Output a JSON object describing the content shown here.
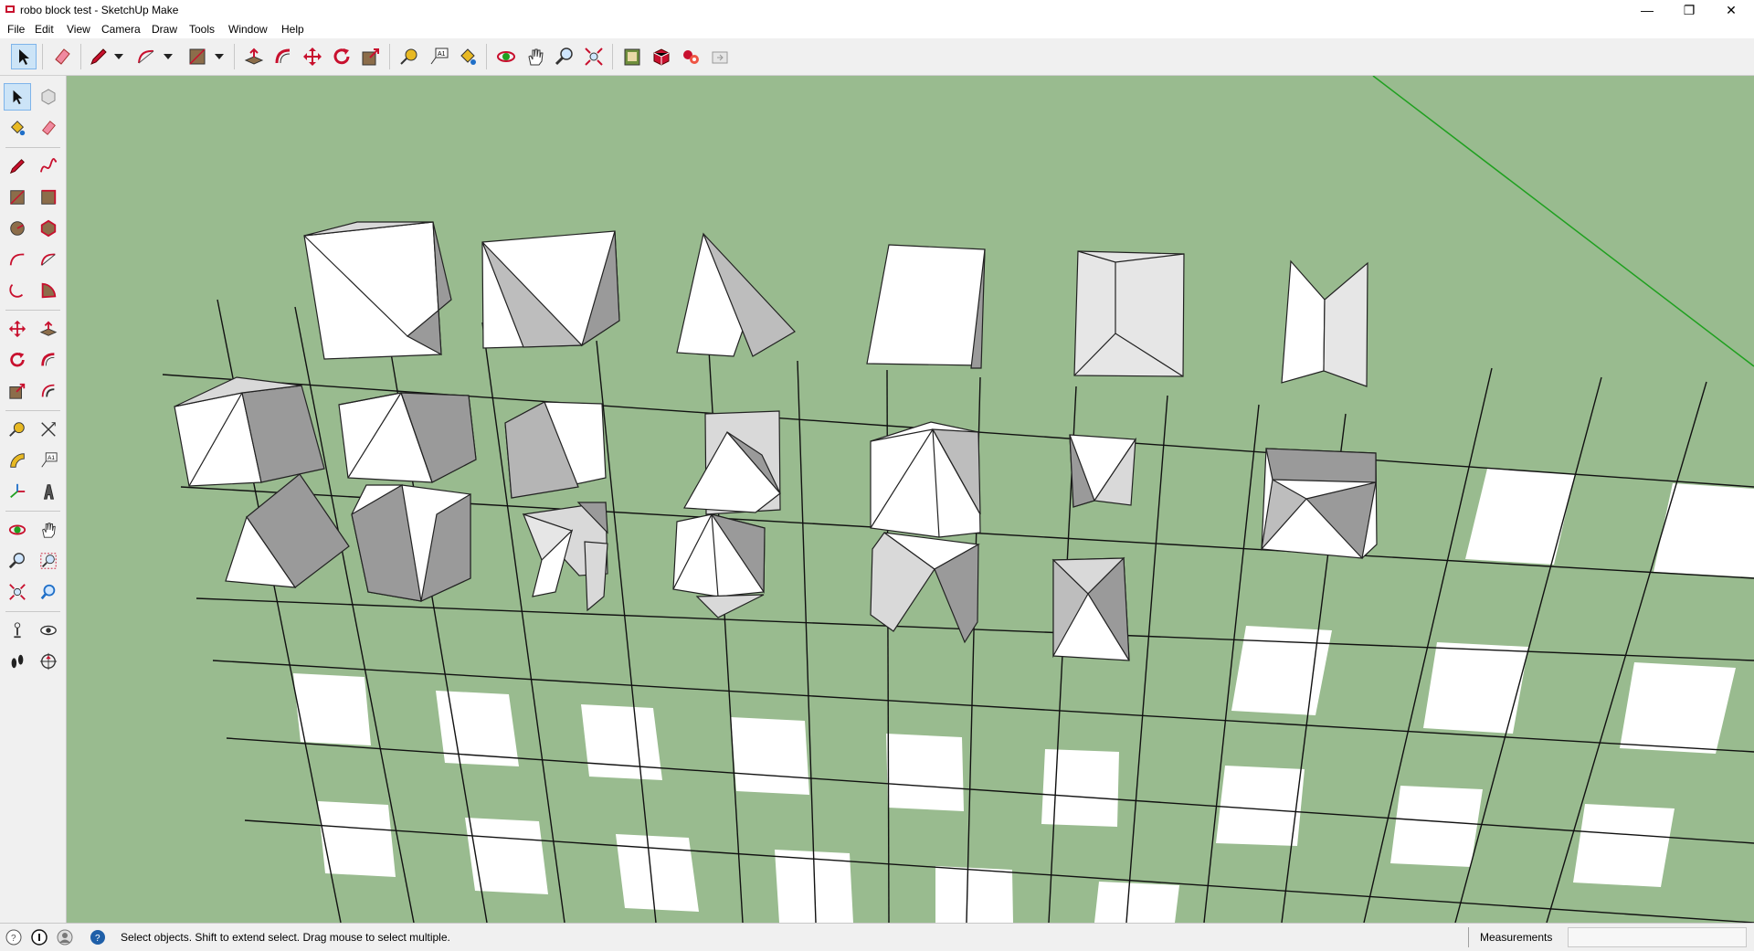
{
  "window": {
    "title": "robo block test - SketchUp Make",
    "minimize_glyph": "—",
    "restore_glyph": "❐",
    "close_glyph": "✕"
  },
  "menu": [
    {
      "label": "File"
    },
    {
      "label": "Edit"
    },
    {
      "label": "View"
    },
    {
      "label": "Camera"
    },
    {
      "label": "Draw"
    },
    {
      "label": "Tools"
    },
    {
      "label": "Window"
    },
    {
      "label": "Help"
    }
  ],
  "toolbar": {
    "tools": [
      "select-icon",
      "eraser-icon",
      "pencil-icon",
      "arc-icon",
      "rectangle-icon",
      "push-pull-icon",
      "follow-me-icon",
      "move-icon",
      "rotate-icon",
      "scale-icon",
      "tape-measure-icon",
      "text-icon",
      "paint-bucket-icon",
      "orbit-icon",
      "pan-icon",
      "zoom-icon",
      "zoom-extents-icon",
      "warehouse-icon",
      "extension-warehouse-icon",
      "component-icon",
      "share-model-icon"
    ]
  },
  "left_toolbar": {
    "tools": [
      "select-icon",
      "component-icon",
      "paint-bucket-icon",
      "eraser-icon",
      "line-icon",
      "freehand-icon",
      "rectangle-icon",
      "rotated-rectangle-icon",
      "circle-icon",
      "polygon-icon",
      "arc-icon",
      "two-point-arc-icon",
      "three-point-arc-icon",
      "pie-icon",
      "move-icon",
      "push-pull-icon",
      "rotate-icon",
      "follow-me-icon",
      "scale-icon",
      "offset-icon",
      "tape-measure-icon",
      "dimension-icon",
      "protractor-icon",
      "text-icon",
      "axes-icon",
      "3d-text-icon",
      "orbit-icon",
      "pan-icon",
      "zoom-icon",
      "zoom-window-icon",
      "zoom-extents-icon",
      "previous-icon",
      "position-camera-icon",
      "look-around-icon",
      "walk-icon",
      "section-plane-icon"
    ]
  },
  "status": {
    "message": "Select objects. Shift to extend select. Drag mouse to select multiple.",
    "measurements_label": "Measurements",
    "measurements_value": ""
  },
  "colors": {
    "viewport_bg": "#99bb8f",
    "face_front": "#ffffff",
    "face_light": "#d9d9d9",
    "face_dark": "#9a9a9a",
    "edge": "#000000",
    "green_axis": "#1fa01f"
  }
}
